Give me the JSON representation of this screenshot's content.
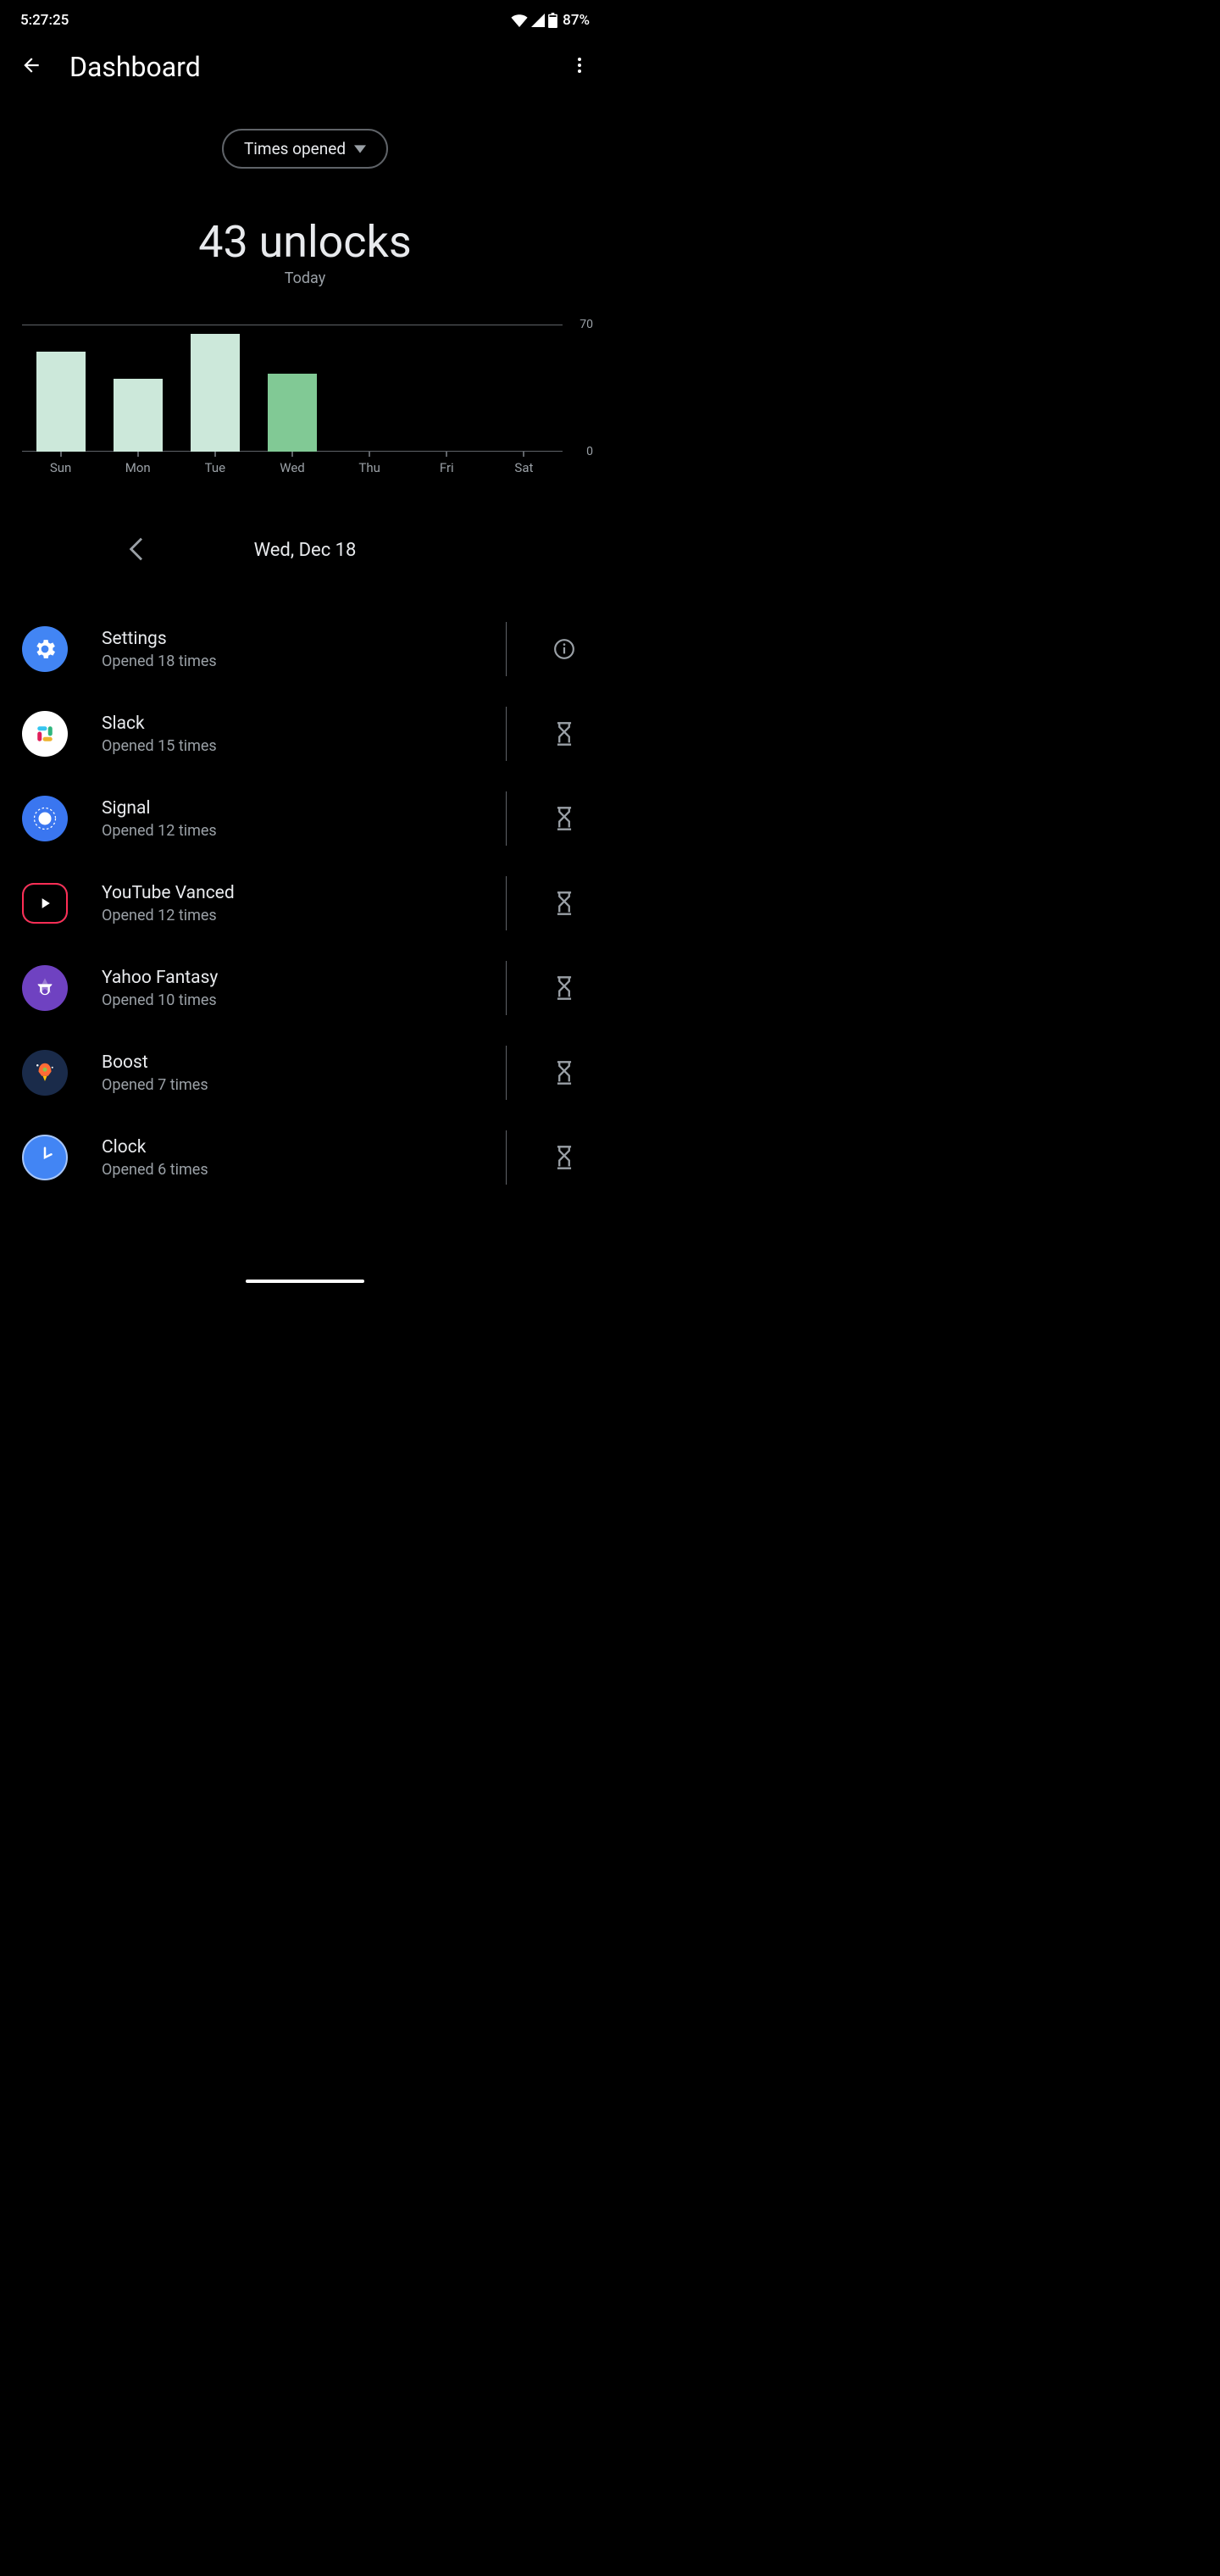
{
  "status_bar": {
    "time": "5:27:25",
    "battery": "87%"
  },
  "app_bar": {
    "title": "Dashboard"
  },
  "filter": {
    "label": "Times opened"
  },
  "metric": {
    "value": "43 unlocks",
    "label": "Today"
  },
  "chart_data": {
    "type": "bar",
    "categories": [
      "Sun",
      "Mon",
      "Tue",
      "Wed",
      "Thu",
      "Fri",
      "Sat"
    ],
    "values": [
      55,
      40,
      65,
      43,
      0,
      0,
      0
    ],
    "current_index": 3,
    "ylim": [
      0,
      70
    ],
    "ytick_top": "70",
    "ytick_bottom": "0"
  },
  "date_nav": {
    "label": "Wed, Dec 18"
  },
  "apps": [
    {
      "name": "Settings",
      "sub": "Opened 18 times",
      "icon": "settings",
      "action": "info"
    },
    {
      "name": "Slack",
      "sub": "Opened 15 times",
      "icon": "slack",
      "action": "timer"
    },
    {
      "name": "Signal",
      "sub": "Opened 12 times",
      "icon": "signal",
      "action": "timer"
    },
    {
      "name": "YouTube Vanced",
      "sub": "Opened 12 times",
      "icon": "youtube",
      "action": "timer"
    },
    {
      "name": "Yahoo Fantasy",
      "sub": "Opened 10 times",
      "icon": "yahoo",
      "action": "timer"
    },
    {
      "name": "Boost",
      "sub": "Opened 7 times",
      "icon": "boost",
      "action": "timer"
    },
    {
      "name": "Clock",
      "sub": "Opened 6 times",
      "icon": "clock",
      "action": "timer"
    }
  ]
}
